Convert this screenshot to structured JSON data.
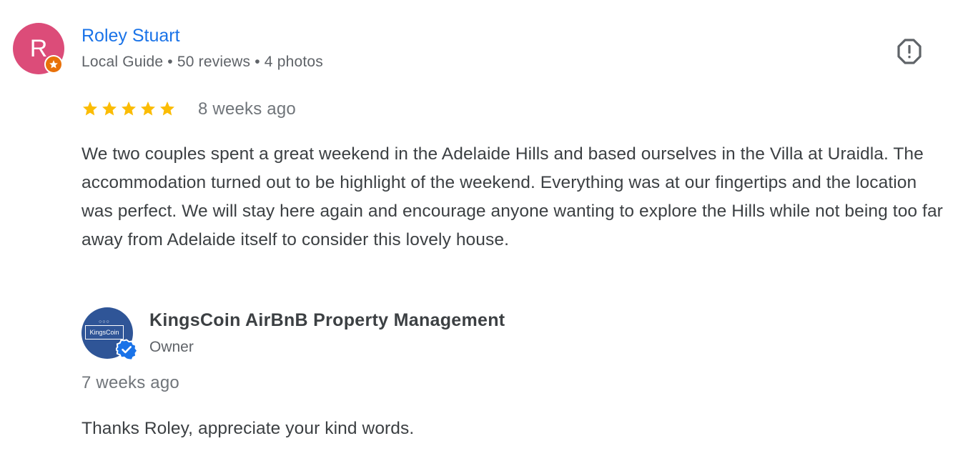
{
  "review": {
    "avatar_initial": "R",
    "avatar_color": "#dc4c79",
    "reviewer_name": "Roley Stuart",
    "meta": {
      "badge": "Local Guide",
      "reviews": "50 reviews",
      "photos": "4 photos",
      "separator": "•"
    },
    "rating": 5,
    "rating_max": 5,
    "time": "8 weeks ago",
    "text": "We two couples spent a great weekend in the Adelaide Hills and based ourselves in the Villa at Uraidla. The accommodation turned out to be highlight of the weekend. Everything was at our fingertips and the location was perfect. We will stay here again and encourage anyone wanting to explore the Hills while not being too far away from Adelaide itself to consider this lovely house.",
    "report_icon": "report-octagon-icon"
  },
  "owner_reply": {
    "name": "KingsCoin AirBnB Property Management",
    "role": "Owner",
    "logo_text": "KingsCoin",
    "avatar_color": "#2f5597",
    "verified_icon": "verified-badge-icon",
    "time": "7 weeks ago",
    "text": "Thanks Roley, appreciate your kind words."
  },
  "colors": {
    "link_blue": "#1a73e8",
    "star_gold": "#fbbc04",
    "local_guide_orange": "#e8710a",
    "verified_blue": "#1a73e8"
  }
}
